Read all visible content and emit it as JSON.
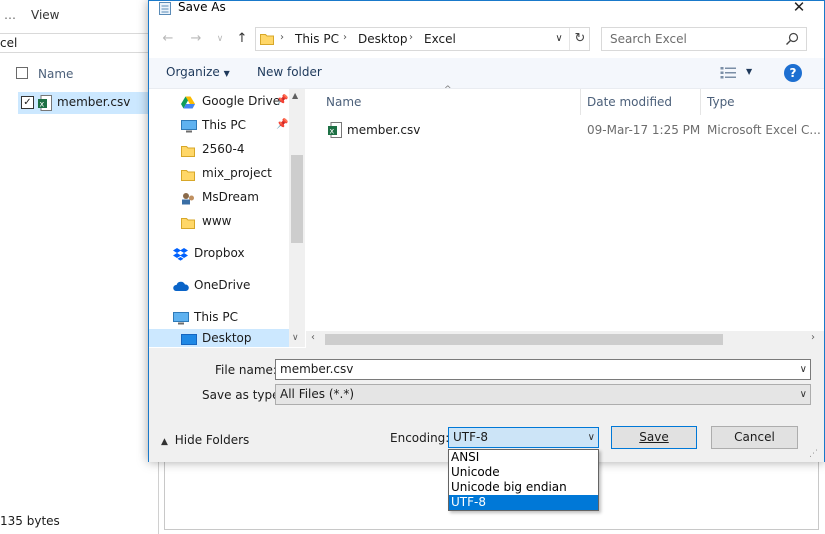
{
  "background": {
    "view_label": "View",
    "address_fragment": "cel",
    "column_name": "Name",
    "file_name": "member.csv",
    "status_text": "135 bytes"
  },
  "dialog": {
    "title": "Save As",
    "close": "✕",
    "breadcrumb": [
      "This PC",
      "Desktop",
      "Excel"
    ],
    "search_placeholder": "Search Excel",
    "toolbar": {
      "organize": "Organize",
      "new_folder": "New folder"
    },
    "nav_items": [
      {
        "label": "Google Drive",
        "icon": "google-drive-icon",
        "pinned": true
      },
      {
        "label": "This PC",
        "icon": "computer-icon",
        "pinned": true
      },
      {
        "label": "2560-4",
        "icon": "folder-icon",
        "pinned": false
      },
      {
        "label": "mix_project",
        "icon": "folder-icon",
        "pinned": false
      },
      {
        "label": "MsDream",
        "icon": "user-folder-icon",
        "pinned": false
      },
      {
        "label": "www",
        "icon": "folder-icon",
        "pinned": false
      },
      {
        "label": "Dropbox",
        "icon": "dropbox-icon",
        "pinned": false
      },
      {
        "label": "OneDrive",
        "icon": "onedrive-icon",
        "pinned": false
      },
      {
        "label": "This PC",
        "icon": "computer-icon",
        "pinned": false
      },
      {
        "label": "Desktop",
        "icon": "desktop-icon",
        "pinned": false,
        "selected": true
      }
    ],
    "columns": [
      "Name",
      "Date modified",
      "Type"
    ],
    "files": [
      {
        "name": "member.csv",
        "date": "09-Mar-17 1:25 PM",
        "type": "Microsoft Excel C..."
      }
    ],
    "file_name_label": "File name:",
    "file_name_value": "member.csv",
    "save_type_label": "Save as type:",
    "save_type_value": "All Files  (*.*)",
    "hide_folders": "Hide Folders",
    "encoding_label": "Encoding:",
    "encoding_value": "UTF-8",
    "encoding_options": [
      "ANSI",
      "Unicode",
      "Unicode big endian",
      "UTF-8"
    ],
    "save_button": "Save",
    "cancel_button": "Cancel"
  },
  "colors": {
    "accent": "#0078d7",
    "title_border": "#1979ca",
    "toolbar_text": "#1e395b"
  }
}
